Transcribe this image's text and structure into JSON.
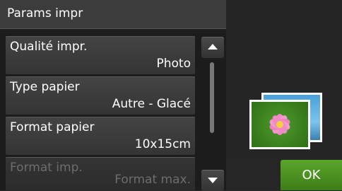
{
  "header": {
    "title": "Params impr"
  },
  "settings": [
    {
      "label": "Qualité impr.",
      "value": "Photo"
    },
    {
      "label": "Type papier",
      "value": "Autre - Glacé"
    },
    {
      "label": "Format papier",
      "value": "10x15cm"
    },
    {
      "label": "Format imp.",
      "value": "Format max."
    }
  ],
  "scroll": {
    "up_icon": "triangle-up",
    "down_icon": "triangle-down"
  },
  "preview": {
    "icon": "photo-flower-icon"
  },
  "ok_button": {
    "label": "OK",
    "color": "#4c9421"
  }
}
